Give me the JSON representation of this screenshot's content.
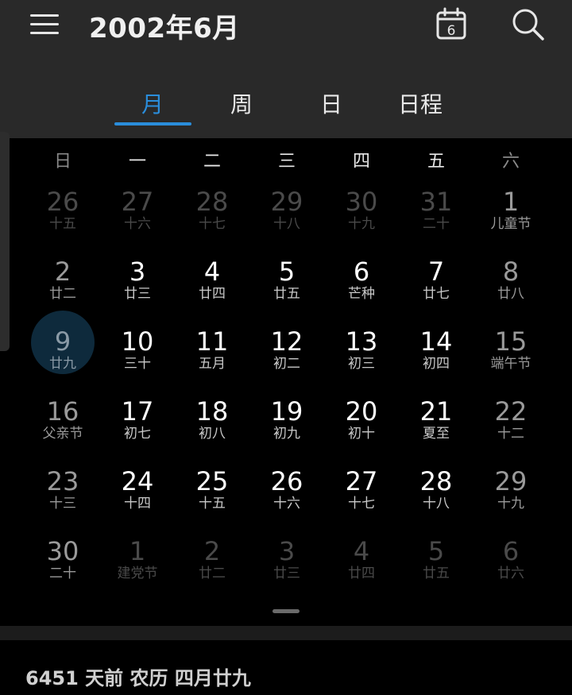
{
  "header": {
    "title": "2002年6月",
    "today_day": "6"
  },
  "tabs": [
    {
      "label": "月",
      "active": true
    },
    {
      "label": "周",
      "active": false
    },
    {
      "label": "日",
      "active": false
    },
    {
      "label": "日程",
      "active": false
    }
  ],
  "weekdays": [
    "日",
    "一",
    "二",
    "三",
    "四",
    "五",
    "六"
  ],
  "weeks": [
    [
      {
        "day": "26",
        "lunar": "十五",
        "other": true
      },
      {
        "day": "27",
        "lunar": "十六",
        "other": true
      },
      {
        "day": "28",
        "lunar": "十七",
        "other": true
      },
      {
        "day": "29",
        "lunar": "十八",
        "other": true
      },
      {
        "day": "30",
        "lunar": "十九",
        "other": true
      },
      {
        "day": "31",
        "lunar": "二十",
        "other": true
      },
      {
        "day": "1",
        "lunar": "儿童节",
        "other": false
      }
    ],
    [
      {
        "day": "2",
        "lunar": "廿二",
        "other": false
      },
      {
        "day": "3",
        "lunar": "廿三",
        "other": false
      },
      {
        "day": "4",
        "lunar": "廿四",
        "other": false
      },
      {
        "day": "5",
        "lunar": "廿五",
        "other": false
      },
      {
        "day": "6",
        "lunar": "芒种",
        "other": false
      },
      {
        "day": "7",
        "lunar": "廿七",
        "other": false
      },
      {
        "day": "8",
        "lunar": "廿八",
        "other": false
      }
    ],
    [
      {
        "day": "9",
        "lunar": "廿九",
        "other": false,
        "selected": true
      },
      {
        "day": "10",
        "lunar": "三十",
        "other": false
      },
      {
        "day": "11",
        "lunar": "五月",
        "other": false
      },
      {
        "day": "12",
        "lunar": "初二",
        "other": false
      },
      {
        "day": "13",
        "lunar": "初三",
        "other": false
      },
      {
        "day": "14",
        "lunar": "初四",
        "other": false
      },
      {
        "day": "15",
        "lunar": "端午节",
        "other": false
      }
    ],
    [
      {
        "day": "16",
        "lunar": "父亲节",
        "other": false
      },
      {
        "day": "17",
        "lunar": "初七",
        "other": false
      },
      {
        "day": "18",
        "lunar": "初八",
        "other": false
      },
      {
        "day": "19",
        "lunar": "初九",
        "other": false
      },
      {
        "day": "20",
        "lunar": "初十",
        "other": false
      },
      {
        "day": "21",
        "lunar": "夏至",
        "other": false
      },
      {
        "day": "22",
        "lunar": "十二",
        "other": false
      }
    ],
    [
      {
        "day": "23",
        "lunar": "十三",
        "other": false
      },
      {
        "day": "24",
        "lunar": "十四",
        "other": false
      },
      {
        "day": "25",
        "lunar": "十五",
        "other": false
      },
      {
        "day": "26",
        "lunar": "十六",
        "other": false
      },
      {
        "day": "27",
        "lunar": "十七",
        "other": false
      },
      {
        "day": "28",
        "lunar": "十八",
        "other": false
      },
      {
        "day": "29",
        "lunar": "十九",
        "other": false
      }
    ],
    [
      {
        "day": "30",
        "lunar": "二十",
        "other": false
      },
      {
        "day": "1",
        "lunar": "建党节",
        "other": true
      },
      {
        "day": "2",
        "lunar": "廿二",
        "other": true
      },
      {
        "day": "3",
        "lunar": "廿三",
        "other": true
      },
      {
        "day": "4",
        "lunar": "廿四",
        "other": true
      },
      {
        "day": "5",
        "lunar": "廿五",
        "other": true
      },
      {
        "day": "6",
        "lunar": "廿六",
        "other": true
      }
    ]
  ],
  "footer": {
    "info": "6451 天前  农历 四月廿九"
  },
  "colors": {
    "accent": "#2a8ddb",
    "header_bg": "#292929",
    "body_bg": "#000000",
    "selected_circle": "#0e2a3c"
  },
  "icons": [
    "menu-icon",
    "calendar-today-icon",
    "search-icon"
  ]
}
